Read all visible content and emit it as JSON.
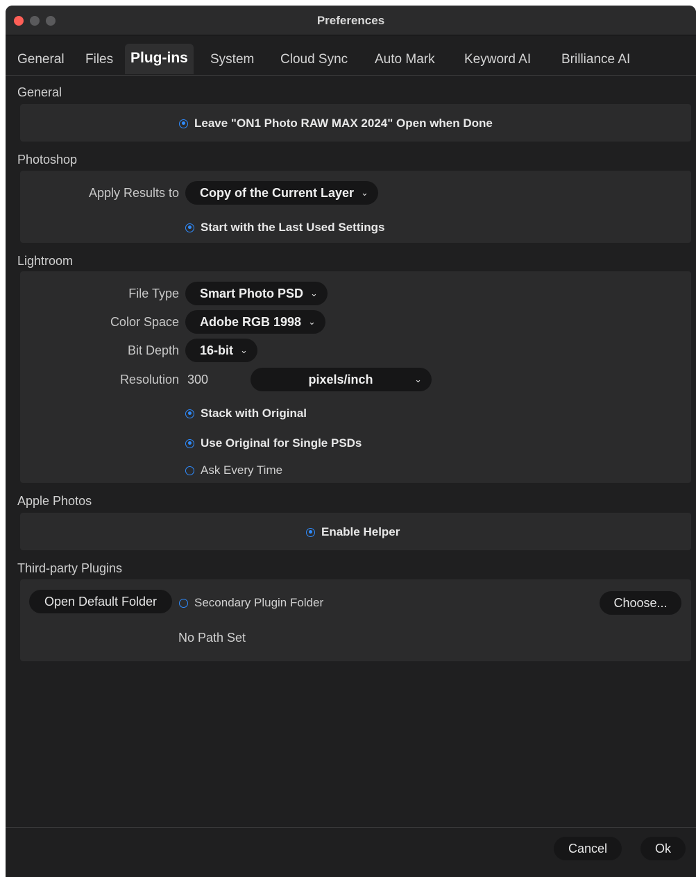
{
  "window": {
    "title": "Preferences"
  },
  "tabs": [
    {
      "label": "General"
    },
    {
      "label": "Files"
    },
    {
      "label": "Plug-ins"
    },
    {
      "label": "System"
    },
    {
      "label": "Cloud Sync"
    },
    {
      "label": "Auto Mark"
    },
    {
      "label": "Keyword AI"
    },
    {
      "label": "Brilliance AI"
    }
  ],
  "active_tab": "Plug-ins",
  "general": {
    "heading": "General",
    "leave_open_label": "Leave \"ON1 Photo RAW MAX 2024\" Open when Done",
    "leave_open_checked": true
  },
  "photoshop": {
    "heading": "Photoshop",
    "apply_results_label": "Apply Results to",
    "apply_results_value": "Copy of the Current Layer",
    "start_last_label": "Start with the Last Used Settings",
    "start_last_checked": true
  },
  "lightroom": {
    "heading": "Lightroom",
    "file_type_label": "File Type",
    "file_type_value": "Smart Photo PSD",
    "color_space_label": "Color Space",
    "color_space_value": "Adobe RGB 1998",
    "bit_depth_label": "Bit Depth",
    "bit_depth_value": "16-bit",
    "resolution_label": "Resolution",
    "resolution_value": "300",
    "resolution_unit": "pixels/inch",
    "stack_label": "Stack with Original",
    "use_original_label": "Use Original for Single PSDs",
    "ask_label": "Ask Every Time"
  },
  "apple_photos": {
    "heading": "Apple Photos",
    "enable_helper_label": "Enable Helper"
  },
  "third_party": {
    "heading": "Third-party Plugins",
    "open_default_label": "Open Default Folder",
    "secondary_label": "Secondary Plugin Folder",
    "choose_label": "Choose...",
    "path_status": "No Path Set"
  },
  "footer": {
    "cancel_label": "Cancel",
    "ok_label": "Ok"
  },
  "colors": {
    "accent": "#2f8cff",
    "background": "#1f1f20",
    "panel": "#2b2b2c",
    "close": "#fe5f57"
  },
  "icons": {
    "dropdown": "chevron-down-icon",
    "radio_selected": "radio-selected-icon",
    "radio_empty": "radio-empty-icon"
  }
}
